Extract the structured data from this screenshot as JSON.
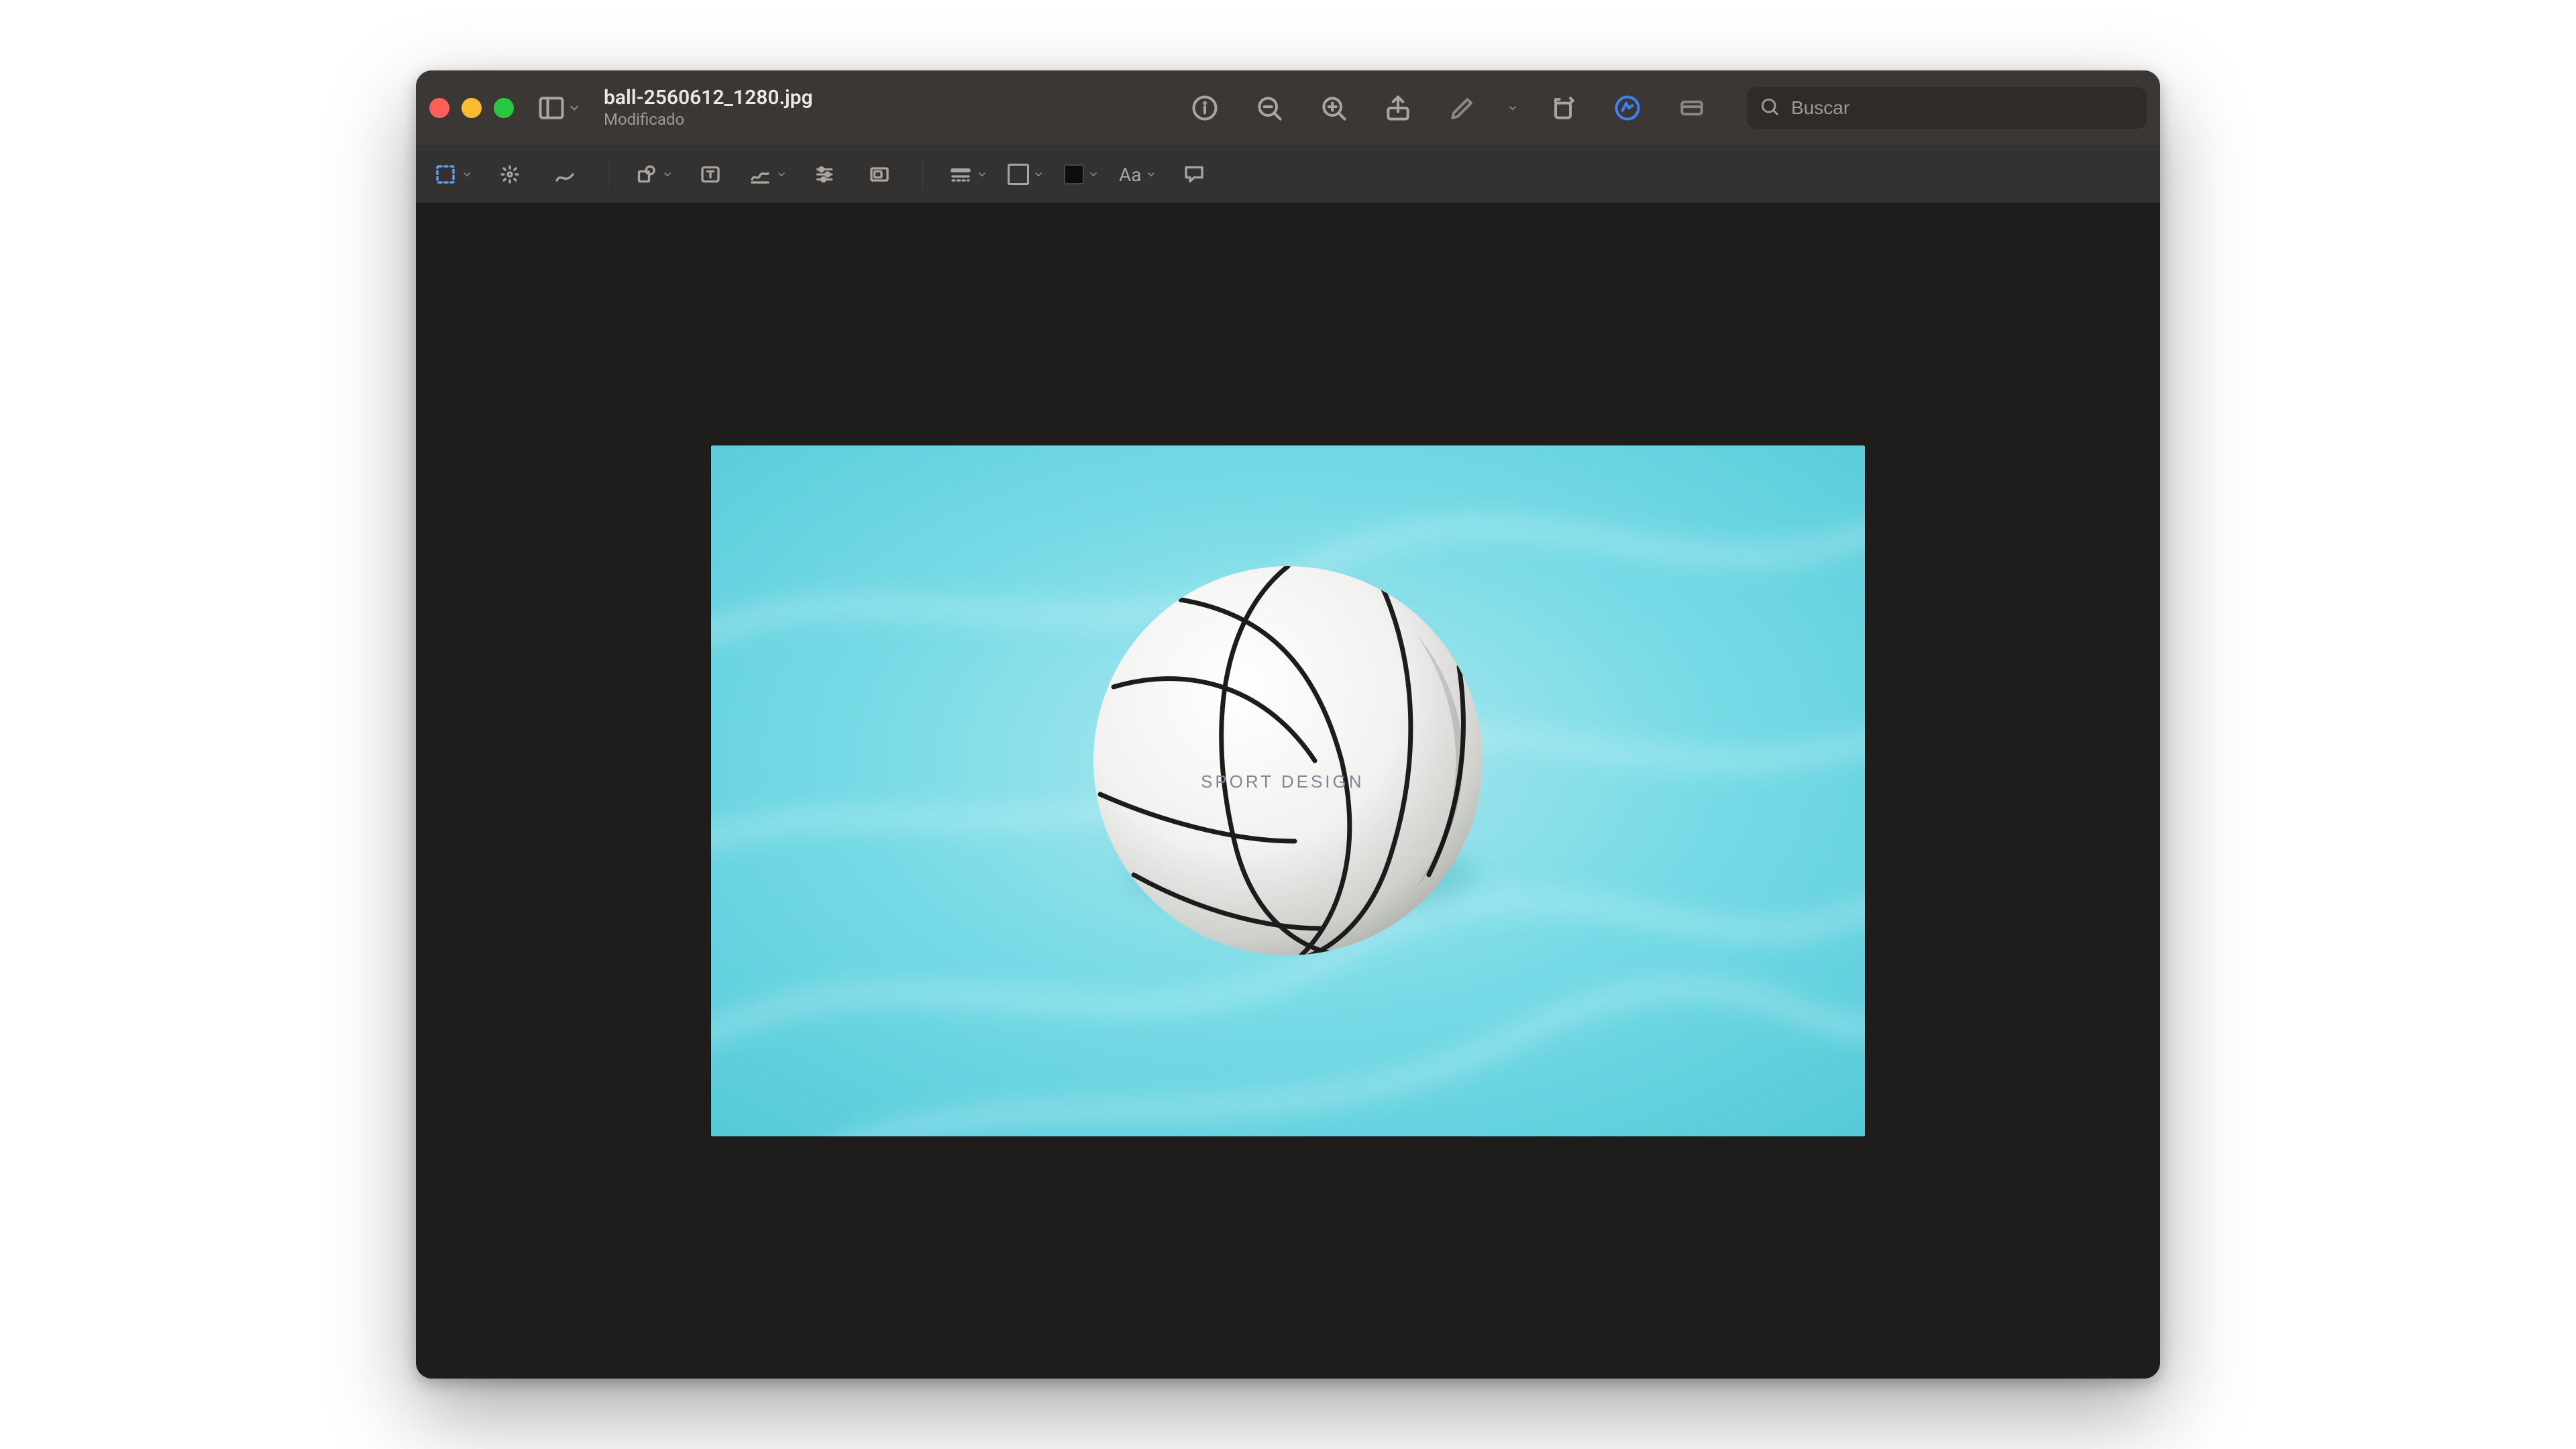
{
  "window": {
    "filename": "ball-2560612_1280.jpg",
    "status": "Modificado"
  },
  "search": {
    "placeholder": "Buscar",
    "value": ""
  },
  "toolbar": {
    "sidebar": "sidebar",
    "info": "info",
    "zoom_out": "zoom-out",
    "zoom_in": "zoom-in",
    "share": "share",
    "markup": "markup",
    "rotate": "rotate",
    "annotate": "annotate",
    "crop": "crop"
  },
  "editbar": {
    "select_rect": "selection",
    "magic": "instant-alpha",
    "sketch": "sketch",
    "shapes": "shapes",
    "text": "text",
    "sign": "signature",
    "adjust": "adjust-color",
    "size": "adjust-size",
    "border_style": "border-style",
    "stroke_color": "stroke-color",
    "fill_color": "fill-color",
    "text_style_label": "Aa",
    "speech": "speech-bubble"
  },
  "image": {
    "description": "White volleyball floating on light turquoise pool water",
    "ball_label": "SPORT DESIGN"
  },
  "colors": {
    "accent": "#3b82f6",
    "water": "#6cd6e3",
    "water_light": "#aee8ef"
  }
}
